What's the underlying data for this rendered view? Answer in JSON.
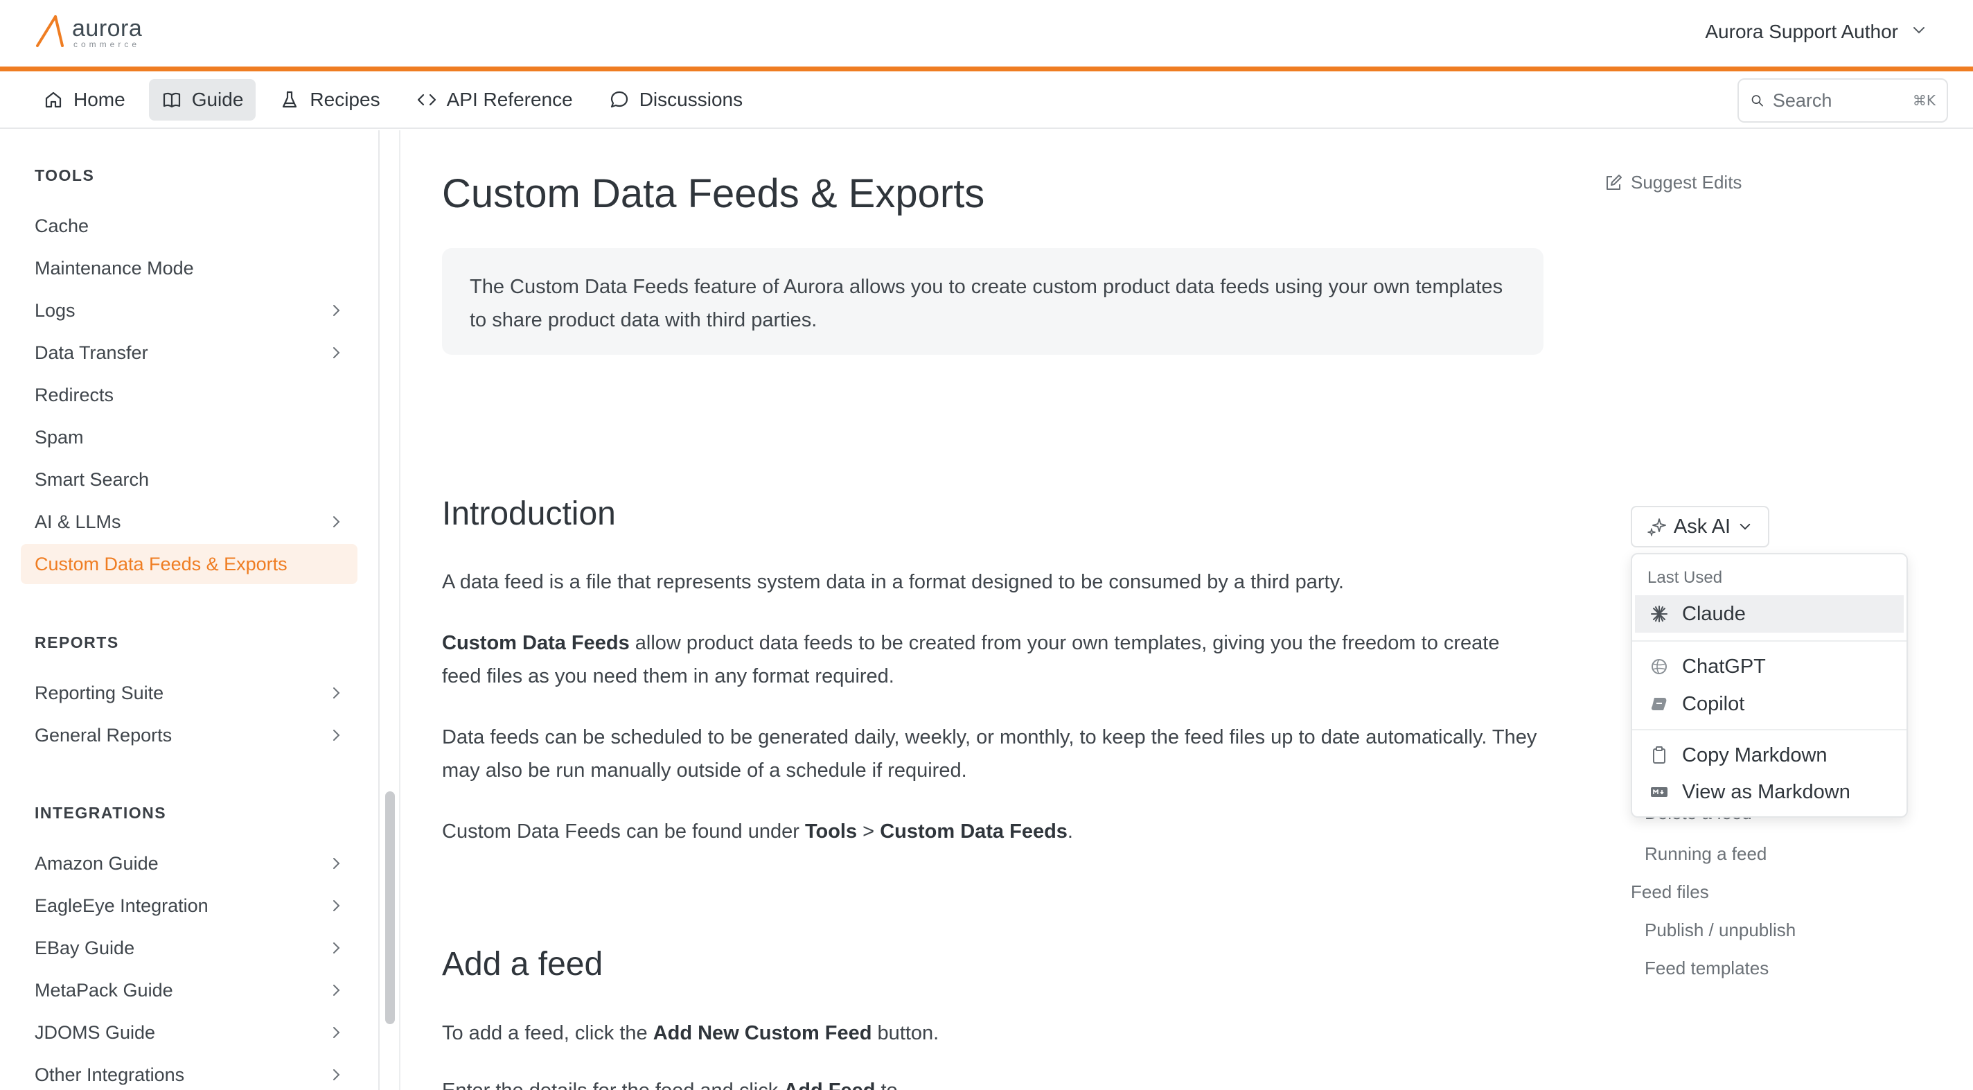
{
  "brand": {
    "name": "aurora",
    "tagline": "commerce",
    "accent": "#ef7d22"
  },
  "user": {
    "name": "Aurora Support Author"
  },
  "nav": {
    "items": [
      {
        "label": "Home",
        "icon": "home-icon"
      },
      {
        "label": "Guide",
        "icon": "book-icon",
        "active": true
      },
      {
        "label": "Recipes",
        "icon": "flask-icon"
      },
      {
        "label": "API Reference",
        "icon": "code-icon"
      },
      {
        "label": "Discussions",
        "icon": "chat-bubble-icon"
      }
    ],
    "search": {
      "placeholder": "Search",
      "shortcut": "⌘K"
    }
  },
  "sidebar": {
    "sections": [
      {
        "title": "TOOLS",
        "items": [
          {
            "label": "Cache"
          },
          {
            "label": "Maintenance Mode"
          },
          {
            "label": "Logs",
            "expandable": true
          },
          {
            "label": "Data Transfer",
            "expandable": true
          },
          {
            "label": "Redirects"
          },
          {
            "label": "Spam"
          },
          {
            "label": "Smart Search"
          },
          {
            "label": "AI & LLMs",
            "expandable": true
          },
          {
            "label": "Custom Data Feeds & Exports",
            "active": true
          }
        ]
      },
      {
        "title": "REPORTS",
        "items": [
          {
            "label": "Reporting Suite",
            "expandable": true
          },
          {
            "label": "General Reports",
            "expandable": true
          }
        ]
      },
      {
        "title": "INTEGRATIONS",
        "items": [
          {
            "label": "Amazon Guide",
            "expandable": true
          },
          {
            "label": "EagleEye Integration",
            "expandable": true
          },
          {
            "label": "EBay Guide",
            "expandable": true
          },
          {
            "label": "MetaPack Guide",
            "expandable": true
          },
          {
            "label": "JDOMS Guide",
            "expandable": true
          },
          {
            "label": "Other Integrations",
            "expandable": true
          }
        ]
      }
    ]
  },
  "page": {
    "title": "Custom Data Feeds & Exports",
    "suggest_edits": "Suggest Edits",
    "excerpt": "The Custom Data Feeds feature of Aurora allows you to create custom product data feeds using your own templates to share product data with third parties.",
    "intro": {
      "heading": "Introduction",
      "p1": "A data feed is a file that represents system data in a format designed to be consumed by a third party.",
      "p2_bold": "Custom Data Feeds",
      "p2_rest": " allow product data feeds to be created from your own templates, giving you the freedom to create feed files as you need them in any format required.",
      "p3": "Data feeds can be scheduled to be generated daily, weekly, or monthly, to keep the feed files up to date automatically. They may also be run manually outside of a schedule if required.",
      "p4_pre": "Custom Data Feeds can be found under ",
      "p4_b1": "Tools",
      "p4_mid": " > ",
      "p4_b2": "Custom Data Feeds",
      "p4_end": "."
    },
    "add_feed": {
      "heading": "Add a feed",
      "p1_pre": "To add a feed, click the ",
      "p1_bold": "Add New Custom Feed",
      "p1_end": " button.",
      "p2_pre": "Enter the details for the feed and click ",
      "p2_bold": "Add Feed",
      "p2_end": " to"
    }
  },
  "ask_ai": {
    "label": "Ask AI",
    "last_used_label": "Last Used",
    "items": [
      {
        "label": "Claude",
        "icon": "claude-icon",
        "highlighted": true
      },
      {
        "label": "ChatGPT",
        "icon": "chatgpt-icon"
      },
      {
        "label": "Copilot",
        "icon": "copilot-icon"
      },
      {
        "label": "Copy Markdown",
        "icon": "clipboard-icon"
      },
      {
        "label": "View as Markdown",
        "icon": "markdown-icon"
      }
    ]
  },
  "toc": {
    "items": [
      {
        "label": "Delete a feed",
        "level": 2
      },
      {
        "label": "Running a feed",
        "level": 2
      },
      {
        "label": "Feed files",
        "level": 1
      },
      {
        "label": "Publish / unpublish",
        "level": 2
      },
      {
        "label": "Feed templates",
        "level": 2
      }
    ]
  }
}
